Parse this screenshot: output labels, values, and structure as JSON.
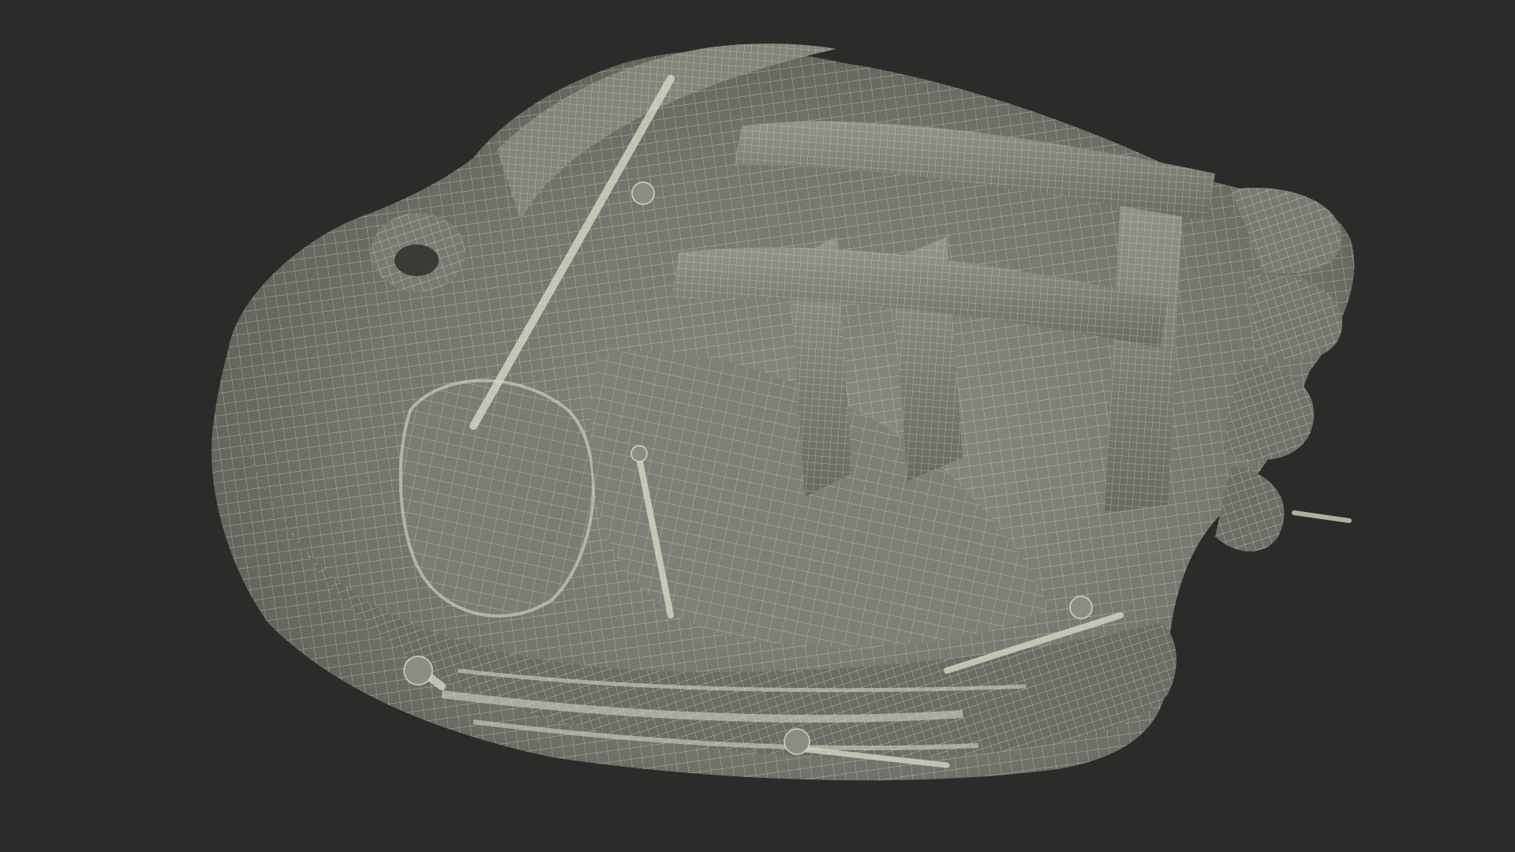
{
  "scene": {
    "subject": "baseball-glove-wireframe-render",
    "style": "wireframe-mesh-on-clay-shading"
  },
  "colors": {
    "background": "#2b2b2a",
    "clay_light": "#8f8f86",
    "clay_mid": "#75756d",
    "clay_dark": "#5b5b54",
    "clay_shadow": "#44443f",
    "wire": "#e6e6d6"
  },
  "icons": []
}
